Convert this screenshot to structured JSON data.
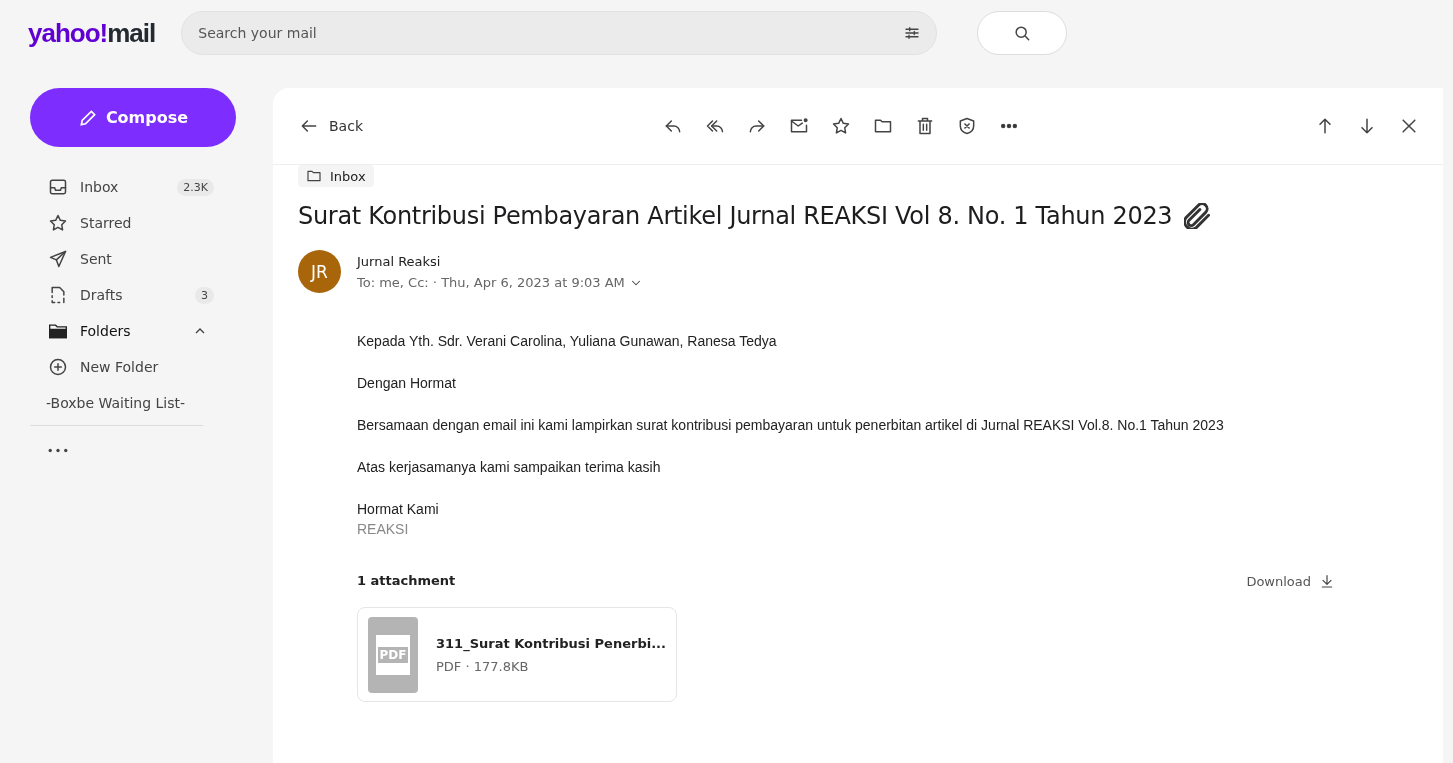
{
  "logo": {
    "brand": "yahoo!",
    "product": "mail"
  },
  "search": {
    "placeholder": "Search your mail"
  },
  "compose": {
    "label": "Compose"
  },
  "sidebar": {
    "items": [
      {
        "kind": "inbox",
        "label": "Inbox",
        "count": "2.3K"
      },
      {
        "kind": "starred",
        "label": "Starred"
      },
      {
        "kind": "sent",
        "label": "Sent"
      },
      {
        "kind": "drafts",
        "label": "Drafts",
        "count": "3"
      },
      {
        "kind": "folders",
        "label": "Folders",
        "expanded": true
      },
      {
        "kind": "new-folder",
        "label": "New Folder"
      },
      {
        "kind": "folder",
        "label": "-Boxbe Waiting List-"
      }
    ]
  },
  "toolbar": {
    "back": "Back"
  },
  "message": {
    "folder": "Inbox",
    "subject": "Surat Kontribusi Pembayaran Artikel Jurnal REAKSI Vol 8. No. 1 Tahun 2023",
    "has_attachment": true,
    "sender": {
      "initials": "JR",
      "name": "Jurnal Reaksi",
      "color": "#a8650a"
    },
    "recipients": "To:  me, Cc:  · Thu, Apr 6, 2023 at 9:03 AM",
    "body": [
      {
        "kind": "para",
        "text": "Kepada Yth. Sdr. Verani Carolina, Yuliana Gunawan, Ranesa Tedya"
      },
      {
        "kind": "para",
        "text": "Dengan Hormat"
      },
      {
        "kind": "para",
        "text": "Bersamaan dengan email ini  kami lampirkan surat kontribusi pembayaran untuk penerbitan artikel di Jurnal REAKSI Vol.8. No.1 Tahun 2023"
      },
      {
        "kind": "para",
        "text": "Atas kerjasamanya kami sampaikan terima kasih"
      },
      {
        "kind": "sign",
        "text": "Hormat Kami"
      },
      {
        "kind": "muted",
        "text": "REAKSI"
      }
    ]
  },
  "attachments": {
    "title": "1 attachment",
    "download": "Download",
    "files": [
      {
        "icon_text": "PDF",
        "name": "311_Surat Kontribusi Penerbi...",
        "meta": "PDF · 177.8KB"
      }
    ]
  }
}
